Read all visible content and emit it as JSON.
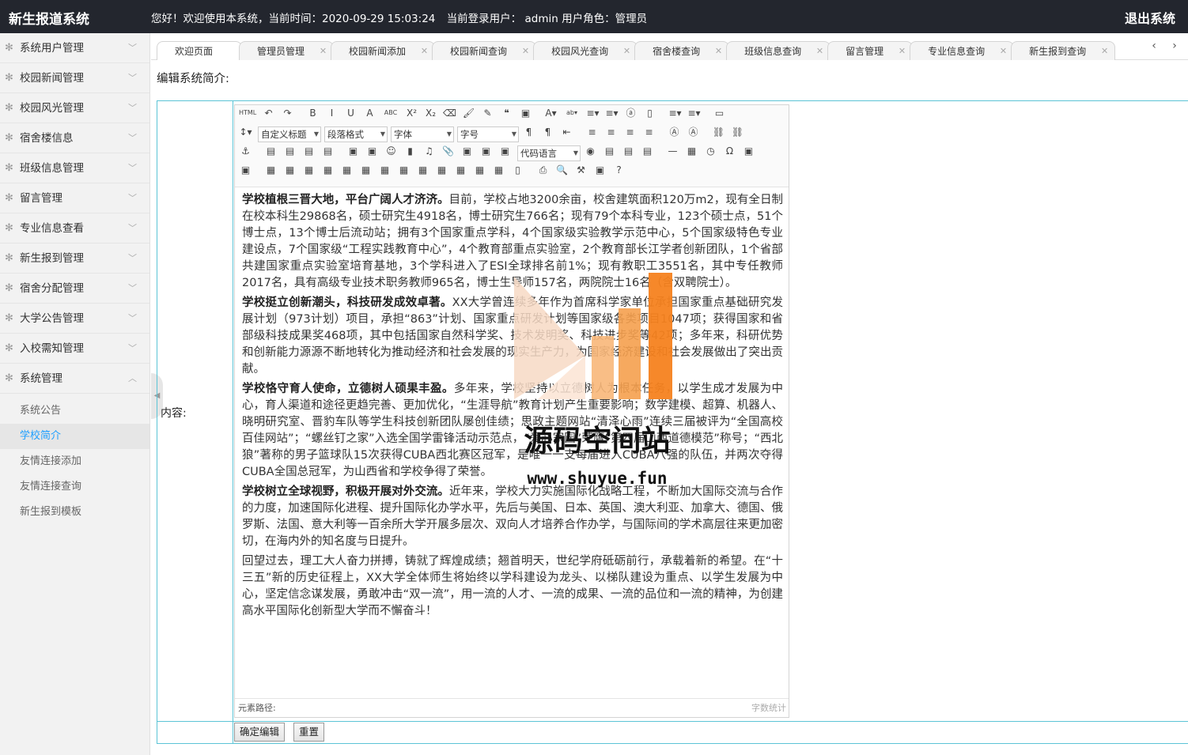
{
  "app": {
    "title": "新生报道系统",
    "greeting": "您好！欢迎使用本系统，当前时间：2020-09-29 15:03:24",
    "user_label": "当前登录用户：  admin  用户角色：管理员",
    "logout_label": "退出系统"
  },
  "sidebar": {
    "items": [
      {
        "label": "系统用户管理"
      },
      {
        "label": "校园新闻管理"
      },
      {
        "label": "校园风光管理"
      },
      {
        "label": "宿舍楼信息"
      },
      {
        "label": "班级信息管理"
      },
      {
        "label": "留言管理"
      },
      {
        "label": "专业信息查看"
      },
      {
        "label": "新生报到管理"
      },
      {
        "label": "宿舍分配管理"
      },
      {
        "label": "大学公告管理"
      },
      {
        "label": "入校需知管理"
      },
      {
        "label": "系统管理"
      }
    ],
    "subitems": [
      {
        "label": "系统公告"
      },
      {
        "label": "学校简介"
      },
      {
        "label": "友情连接添加"
      },
      {
        "label": "友情连接查询"
      },
      {
        "label": "新生报到模板"
      }
    ]
  },
  "tabs": [
    {
      "label": "欢迎页面"
    },
    {
      "label": "管理员管理"
    },
    {
      "label": "校园新闻添加"
    },
    {
      "label": "校园新闻查询"
    },
    {
      "label": "校园风光查询"
    },
    {
      "label": "宿舍楼查询"
    },
    {
      "label": "班级信息查询"
    },
    {
      "label": "留言管理"
    },
    {
      "label": "专业信息查询"
    },
    {
      "label": "新生报到查询"
    }
  ],
  "page": {
    "heading": "编辑系统简介:",
    "content_label": "内容:"
  },
  "toolbar": {
    "custom_title": "自定义标题",
    "paragraph_format": "段落格式",
    "font_family": "字体",
    "font_size": "字号",
    "code_language": "代码语言"
  },
  "editor": {
    "paragraphs": [
      {
        "bold": "学校植根三晋大地，平台广阔人才济济。",
        "text": "目前，学校占地3200余亩，校舍建筑面积120万m2，现有全日制在校本科生29868名，硕士研究生4918名，博士研究生766名；现有79个本科专业，123个硕士点，51个博士点，13个博士后流动站；拥有3个国家重点学科，4个国家级实验教学示范中心，5个国家级特色专业建设点，7个国家级“工程实践教育中心”，4个教育部重点实验室，2个教育部长江学者创新团队，1个省部共建国家重点实验室培育基地，3个学科进入了ESI全球排名前1%；现有教职工3551名，其中专任教师2017名，具有高级专业技术职务教师965名，博士生导师157名，两院院士16名（含双聘院士）。"
      },
      {
        "bold": "学校挺立创新潮头，科技研发成效卓著。",
        "text": "XX大学曾连续多年作为首席科学家单位承担国家重点基础研究发展计划（973计划）项目，承担“863”计划、国家重点研发计划等国家级各类项目1047项；获得国家和省部级科技成果奖468项，其中包括国家自然科学奖、技术发明奖、科技进步奖等42项；多年来，科研优势和创新能力源源不断地转化为推动经济和社会发展的现实生产力，为国家经济建设和社会发展做出了突出贡献。"
      },
      {
        "bold": "学校恪守育人使命，立德树人硕果丰盈。",
        "text": "多年来，学校坚持以立德树人为根本任务，以学生成才发展为中心，育人渠道和途径更趋完善、更加优化，“生涯导航”教育计划产生重要影响；数学建模、超算、机器人、晓明研究室、晋豹车队等学生科技创新团队屡创佳绩；思政主题网站“清泽心雨”连续三届被评为“全国高校百佳网站”；“螺丝钉之家”入选全国学雷锋活动示范点，“爱心家园”荣膺“第四届山西道德模范”称号；“西北狼”著称的男子篮球队15次获得CUBA西北赛区冠军，是唯一一支每届进入CUBA八强的队伍，并两次夺得CUBA全国总冠军，为山西省和学校争得了荣誉。"
      },
      {
        "bold": "学校树立全球视野，积极开展对外交流。",
        "text": "近年来，学校大力实施国际化战略工程，不断加大国际交流与合作的力度，加速国际化进程、提升国际化办学水平，先后与美国、日本、英国、澳大利亚、加拿大、德国、俄罗斯、法国、意大利等一百余所大学开展多层次、双向人才培养合作办学，与国际间的学术高层往来更加密切，在海内外的知名度与日提升。"
      },
      {
        "bold": "",
        "text": "回望过去，理工大人奋力拼搏，铸就了辉煌成绩；翘首明天，世纪学府砥砺前行，承载着新的希望。在“十三五”新的历史征程上，XX大学全体师生将始终以学科建设为龙头、以梯队建设为重点、以学生发展为中心，坚定信念谋发展，勇敢冲击“双一流”，用一流的人才、一流的成果、一流的品位和一流的精神，为创建高水平国际化创新型大学而不懈奋斗！"
      }
    ],
    "status_path": "元素路径:",
    "word_count": "字数统计"
  },
  "buttons": {
    "submit": "确定编辑",
    "reset": "重置"
  },
  "watermark": {
    "title": "源码空间站",
    "url": "www.shuyue.fun"
  },
  "colors": {
    "topbar": "#23262e",
    "sidebar": "#f2f2f2",
    "active_link": "#1e9fff",
    "table_border": "#5bc4d6",
    "watermark_orange": "#f5821f"
  }
}
